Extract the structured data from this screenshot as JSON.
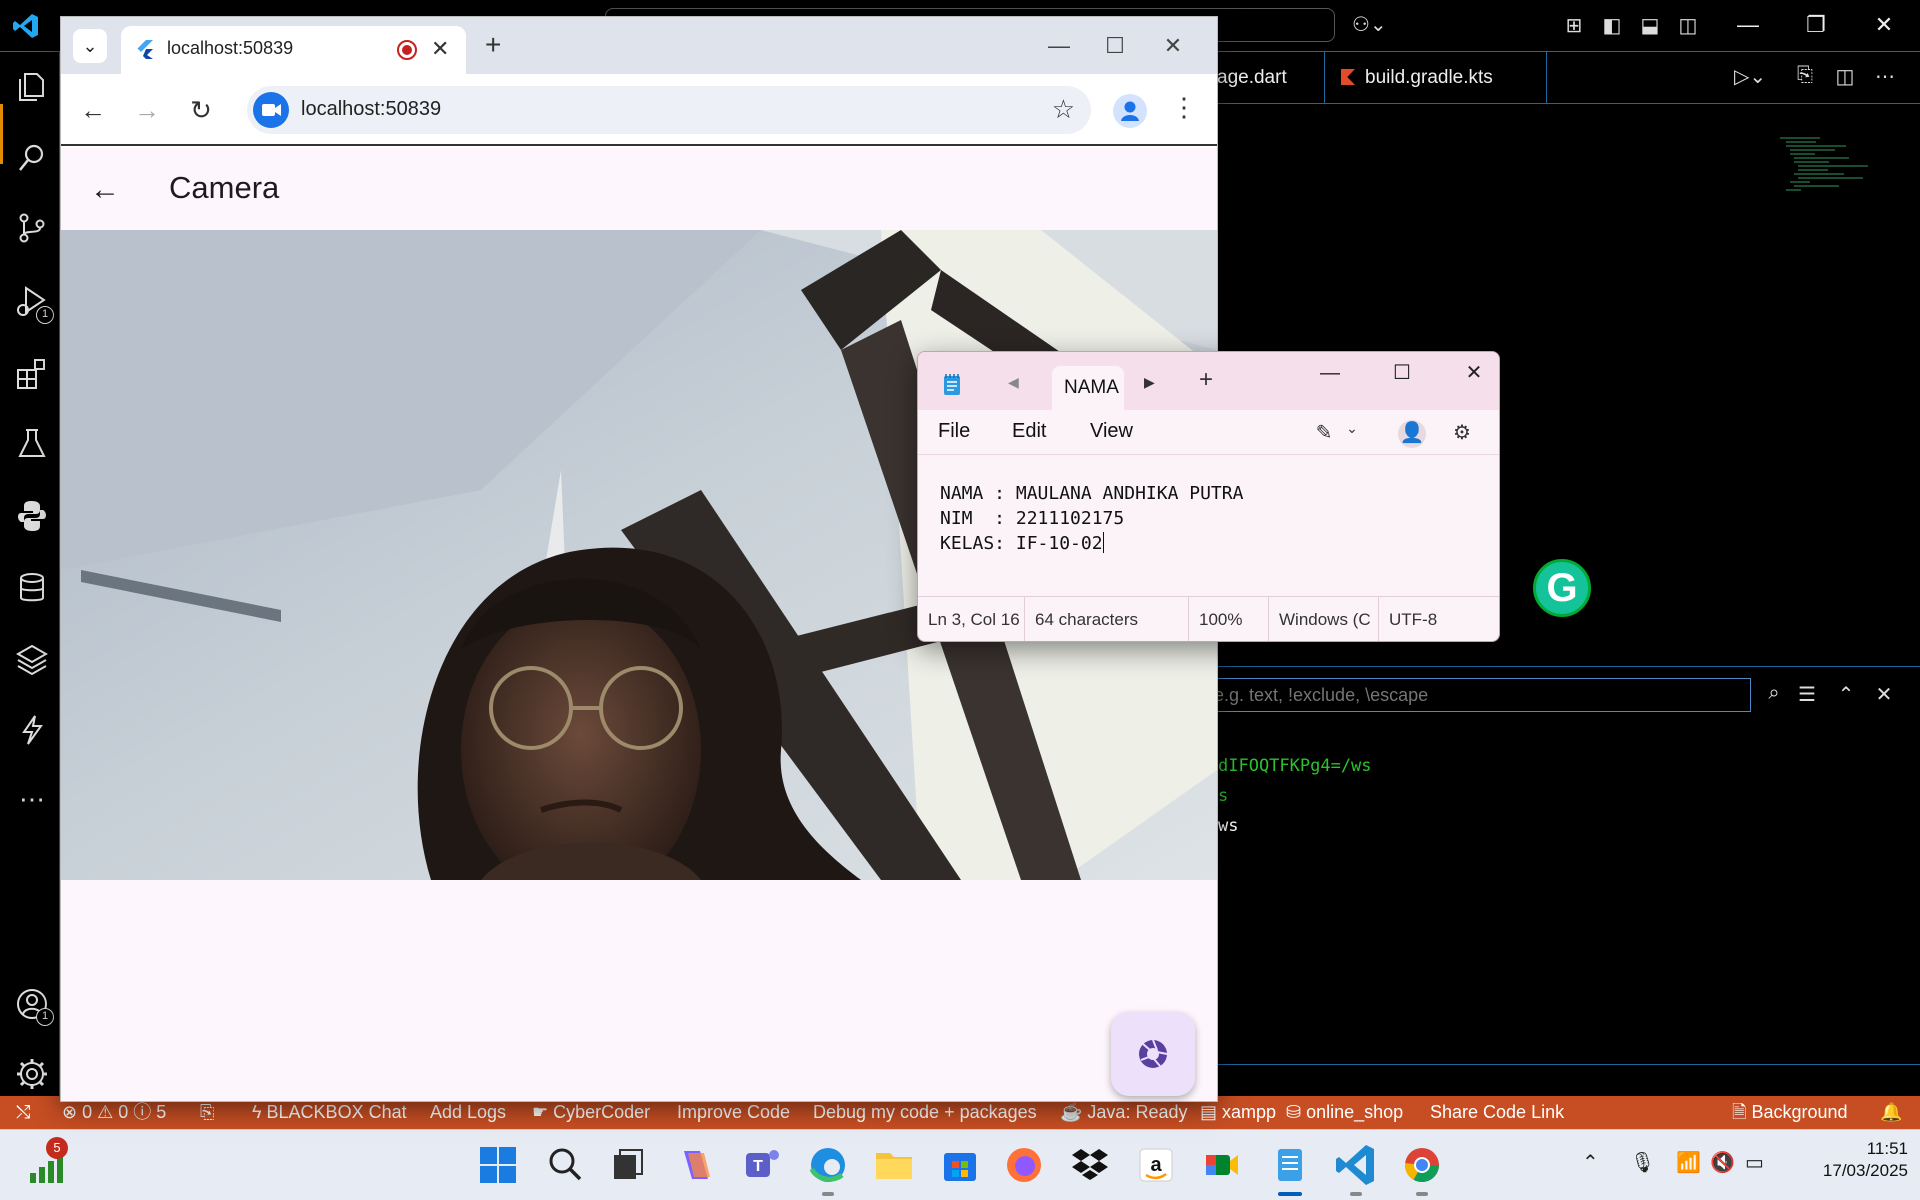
{
  "vscode": {
    "tabs": [
      {
        "label": "age.dart"
      },
      {
        "label": "build.gradle.kts"
      }
    ],
    "find_placeholder": "e.g. text, !exclude, \\escape",
    "terminal_lines": [
      {
        "text": "dIFOQTFKPg4=/ws",
        "color": "#2dc02d"
      },
      {
        "text": "s",
        "color": "#2dc02d"
      },
      {
        "text": "ws",
        "color": "#ffffff"
      }
    ],
    "activity_badges": {
      "run": "1",
      "accounts": "1"
    },
    "accent": "#1a6aa0",
    "statusbar": {
      "problems": "⊗ 0 ⚠ 0 ⓘ 5",
      "blackbox": "BLACKBOX Chat",
      "add_logs": "Add Logs",
      "cybercoder": "CyberCoder",
      "improve": "Improve Code",
      "debug": "Debug my code + packages",
      "java": "Java: Ready",
      "xampp": "xampp",
      "db": "online_shop",
      "share": "Share Code Link",
      "background": "Background",
      "color": "#c74e23"
    }
  },
  "chrome": {
    "tab_title": "localhost:50839",
    "url": "localhost:50839",
    "app": {
      "title": "Camera",
      "background": "#fdf7fd",
      "fab_color": "#ece0fa"
    }
  },
  "notepad": {
    "tab_title": "NAMA",
    "menu": [
      "File",
      "Edit",
      "View"
    ],
    "content_lines": [
      "NAMA : MAULANA ANDHIKA PUTRA",
      "NIM  : 2211102175",
      "KELAS: IF-10-02"
    ],
    "status": {
      "position": "Ln 3, Col 16",
      "chars": "64 characters",
      "zoom": "100%",
      "eol": "Windows (C",
      "encoding": "UTF-8"
    }
  },
  "taskbar": {
    "weather_badge": "5",
    "time": "11:51",
    "date": "17/03/2025"
  }
}
